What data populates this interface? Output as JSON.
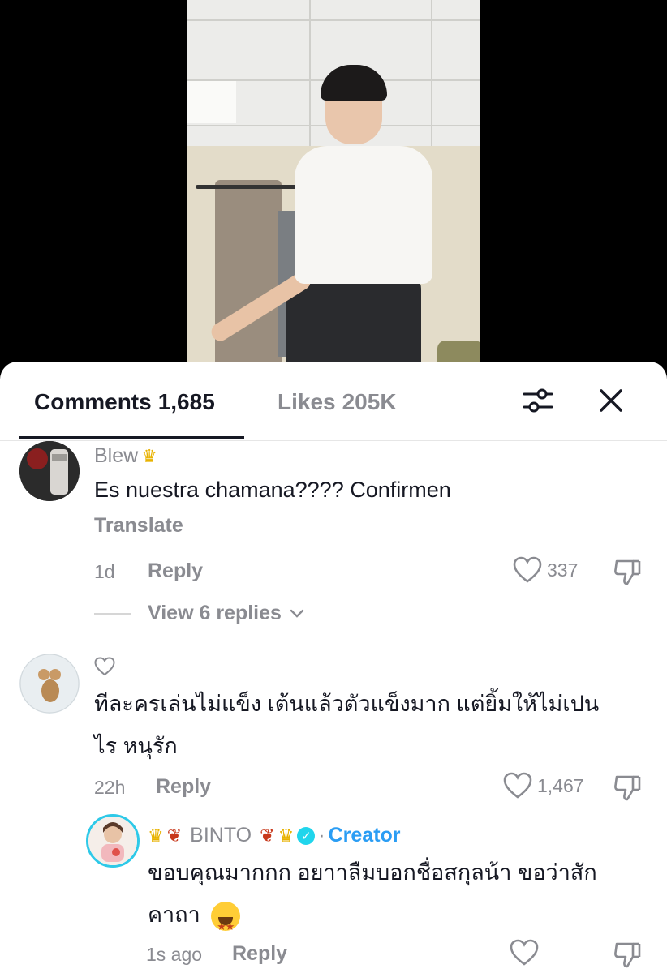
{
  "tabs": {
    "comments_label": "Comments",
    "comments_count": "1,685",
    "likes_label": "Likes",
    "likes_count": "205K"
  },
  "comments": [
    {
      "author": "Blew",
      "text": "Es nuestra chamana???? Confirmen",
      "translate": "Translate",
      "time": "1d",
      "reply": "Reply",
      "likes": "337",
      "view_replies": "View 6 replies"
    },
    {
      "author": "",
      "text_line1": "ทีละครเล่นไม่แข็ง เต้นแล้วตัวแข็งมาก แต่ยิ้มให้ไม่เปน",
      "text_line2": "ไร หนุรัก",
      "time": "22h",
      "reply": "Reply",
      "likes": "1,467"
    },
    {
      "author": "BINTO",
      "creator_tag": "Creator",
      "text_line1": "ขอบคุณมากกก อยาาลืมบอกชื่อสกุลน้า ขอว่าสัก",
      "text_line2": "คาถา",
      "time": "1s ago",
      "reply": "Reply"
    }
  ],
  "colors": {
    "primary_text": "#161823",
    "secondary_text": "#8a8b91",
    "creator_blue": "#2a9df4",
    "verified": "#20d5ec"
  }
}
